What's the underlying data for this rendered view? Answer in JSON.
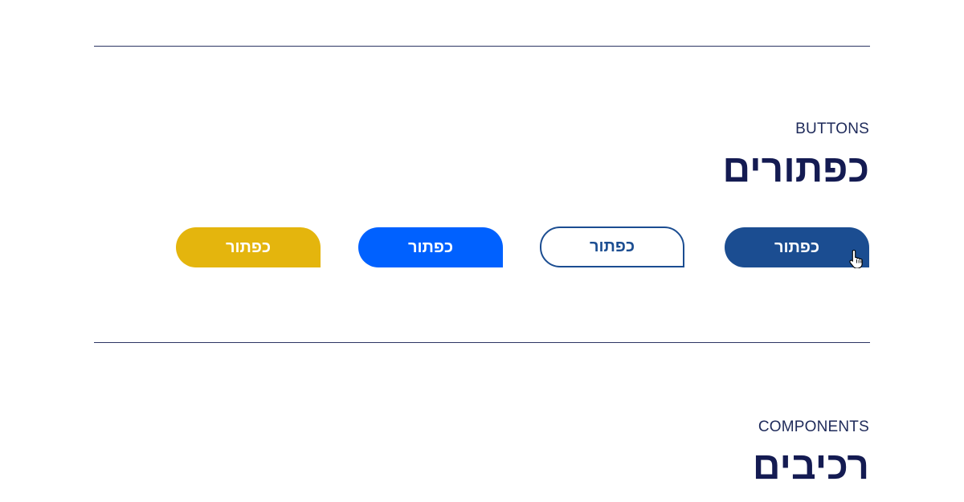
{
  "buttons_section": {
    "eyebrow": "BUTTONS",
    "title": "כפתורים",
    "buttons": [
      {
        "label": "כפתור",
        "variant": "dark",
        "color": "#1b4d91"
      },
      {
        "label": "כפתור",
        "variant": "outline",
        "color": "#1b4d91"
      },
      {
        "label": "כפתור",
        "variant": "blue",
        "color": "#0061ff"
      },
      {
        "label": "כפתור",
        "variant": "yellow",
        "color": "#e4b50d"
      }
    ]
  },
  "components_section": {
    "eyebrow": "COMPONENTS",
    "title": "רכיבים"
  },
  "cursor": {
    "icon": "hand-pointer-icon"
  }
}
